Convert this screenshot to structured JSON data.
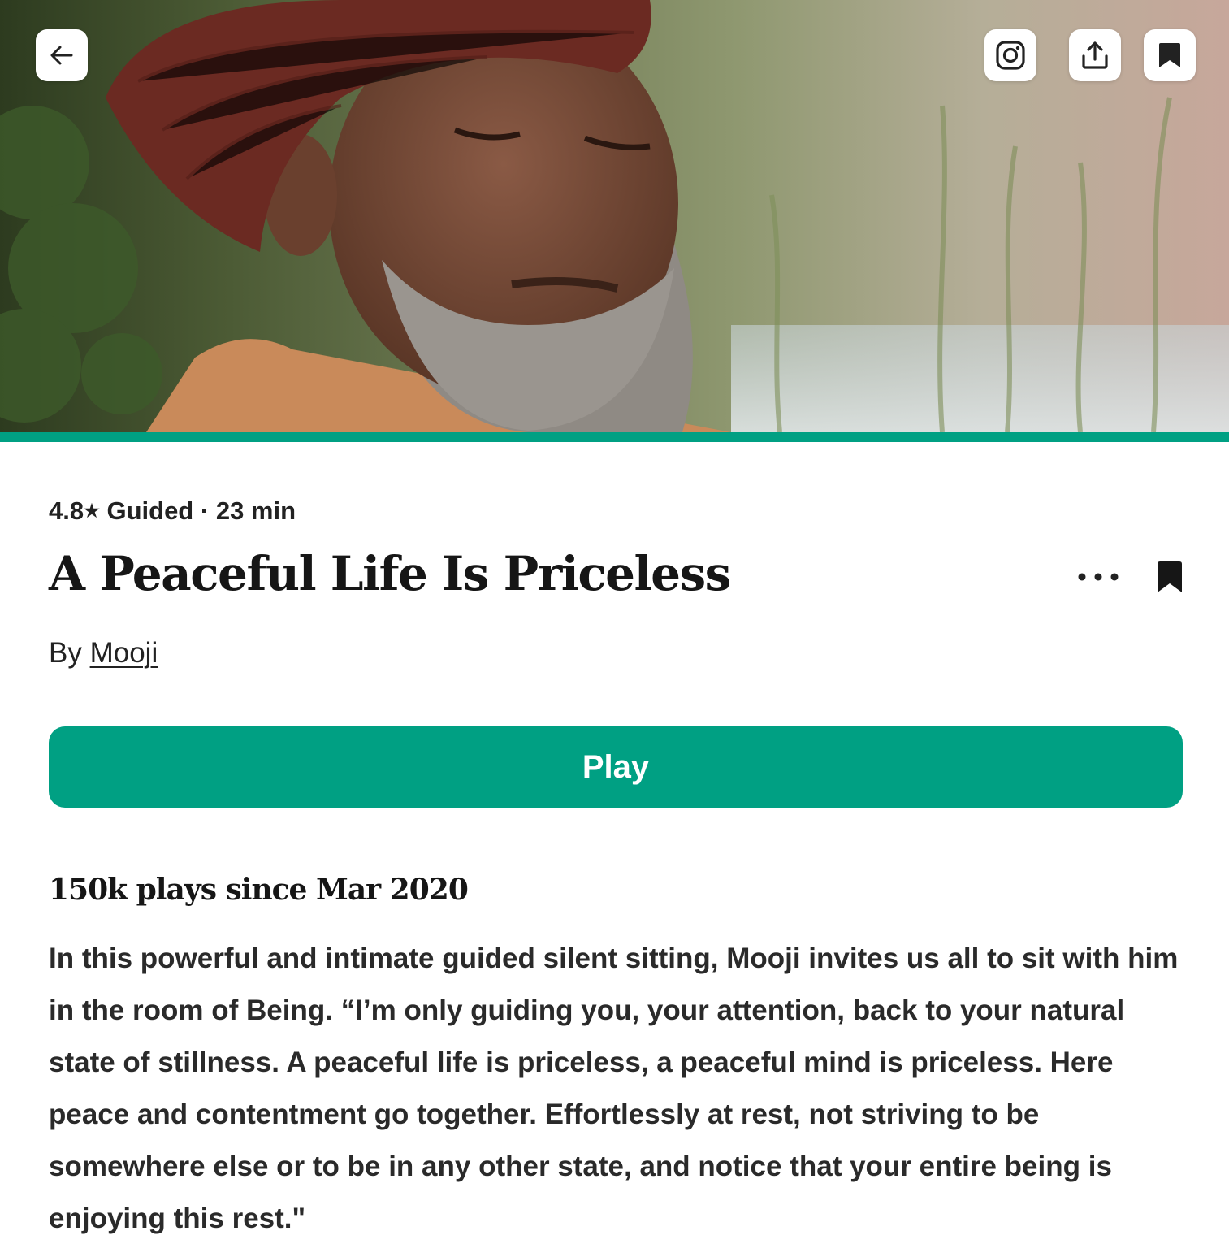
{
  "hero": {
    "progress_fraction": 1.0,
    "accent_color": "#00a083",
    "image_description_icon": "portrait-photo"
  },
  "toolbar": {
    "back_icon": "arrow-left-icon",
    "instagram_icon": "instagram-icon",
    "share_icon": "share-icon",
    "save_icon": "bookmark-icon"
  },
  "meta": {
    "rating": "4.8",
    "star": "★",
    "type": "Guided",
    "separator": "·",
    "duration": "23 min"
  },
  "title": "A Peaceful Life Is Priceless",
  "byline": {
    "prefix": "By",
    "author": "Mooji"
  },
  "play_label": "Play",
  "plays_text": "150k plays since Mar 2020",
  "description": "In this powerful and intimate guided silent sitting, Mooji invites us all to sit with him in the room of Being. “I’m only guiding you, your attention, back to your natural state of stillness. A peaceful life is priceless, a peaceful mind is priceless. Here peace and contentment go together. Effortlessly at rest, not striving to be somewhere else or to be in any other state, and notice that your entire being is enjoying this rest.\""
}
